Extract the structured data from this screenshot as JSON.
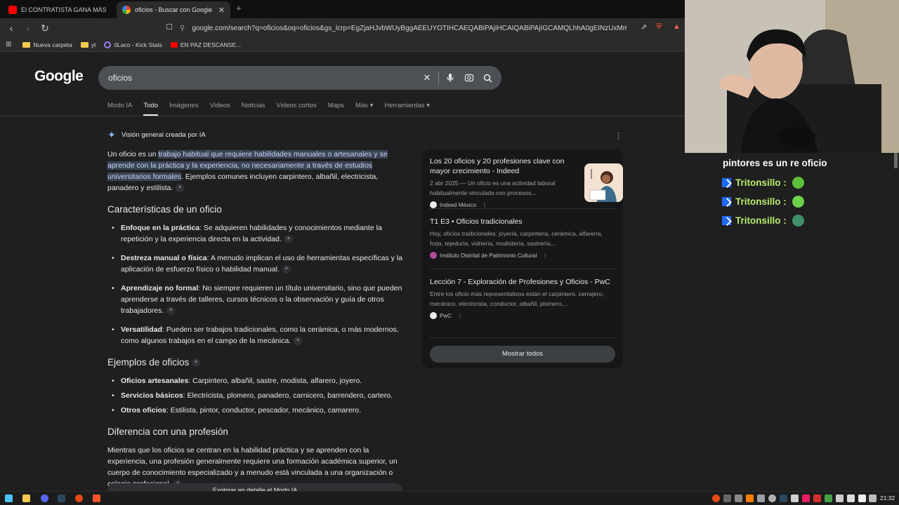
{
  "browser": {
    "tabs": [
      {
        "title": "El CONTRATISTA GANA MÁS #agente",
        "active": false
      },
      {
        "title": "oficios - Buscar con Google",
        "active": true
      }
    ],
    "new_tab": "+",
    "url": "google.com/search?q=oficios&oq=oficios&gs_lcrp=EgZjaHJvbWUyBggAEEUYOTIHCAEQABiPAjIHCAIQABiPAjIGCAMQLhhA0gEINzUxMmowajGoAgC...",
    "bookmarks": [
      {
        "label": "Nueva carpeta",
        "icon": "folder-icon"
      },
      {
        "label": "yt",
        "icon": "folder-icon"
      },
      {
        "label": "0Laco - Kick Stats",
        "icon": "kick-icon"
      },
      {
        "label": "EN PAZ DESCANSE...",
        "icon": "youtube-icon"
      }
    ]
  },
  "google": {
    "logo": "Google",
    "query": "oficios",
    "tabs": [
      "Modo IA",
      "Todo",
      "Imágenes",
      "Videos",
      "Noticias",
      "Videos cortos",
      "Maps",
      "Más",
      "Herramientas"
    ],
    "active_tab": "Todo"
  },
  "ai": {
    "header": "Visión general creada por IA",
    "intro_pre": "Un oficio es un ",
    "intro_hl": "trabajo habitual que requiere habilidades manuales o artesanales y se aprende con la práctica y la experiencia, no necesariamente a través de estudios universitarios formales",
    "intro_post": ". Ejemplos comunes incluyen carpintero, albañil, electricista, panadero y estilista.",
    "sec1_title": "Características de un oficio",
    "sec1_items": [
      {
        "bold": "Enfoque en la práctica",
        "text": ": Se adquieren habilidades y conocimientos mediante la repetición y la experiencia directa en la actividad."
      },
      {
        "bold": "Destreza manual o física",
        "text": ": A menudo implican el uso de herramientas específicas y la aplicación de esfuerzo físico o habilidad manual."
      },
      {
        "bold": "Aprendizaje no formal",
        "text": ": No siempre requieren un título universitario, sino que pueden aprenderse a través de talleres, cursos técnicos o la observación y guía de otros trabajadores."
      },
      {
        "bold": "Versatilidad",
        "text": ": Pueden ser trabajos tradicionales, como la cerámica, o más modernos, como algunos trabajos en el campo de la mecánica."
      }
    ],
    "sec2_title": "Ejemplos de oficios",
    "sec2_items": [
      {
        "bold": "Oficios artesanales",
        "text": ": Carpintero, albañil, sastre, modista, alfarero, joyero."
      },
      {
        "bold": "Servicios básicos",
        "text": ": Electricista, plomero, panadero, carnicero, barrendero, cartero."
      },
      {
        "bold": "Otros oficios",
        "text": ": Estilista, pintor, conductor, pescador, mecánico, camarero."
      }
    ],
    "sec3_title": "Diferencia con una profesión",
    "sec3_text": "Mientras que los oficios se centran en la habilidad práctica y se aprenden con la experiencia, una profesión generalmente requiere una formación académica superior, un cuerpo de conocimiento especializado y a menudo está vinculada a una organización o colegio profesional.",
    "explore_label": "Explorar en detalle el Modo IA"
  },
  "sources": [
    {
      "title": "Los 20 oficios y 20 profesiones clave con mayor crecimiento - Indeed",
      "desc": "2 abr 2025 — Un oficio es una actividad laboral habitualmente vinculada con procesos...",
      "site": "Indeed México",
      "color": "#e8eaed"
    },
    {
      "title": "T1 E3 • Oficios tradicionales",
      "desc": "Hoy, oficios tradicionales: joyería, carpintería, cerámica, alfarería, forja, tejeduría, vidriería, modistería, sastrería,...",
      "site": "Instituto Distrital de Patrimonio Cultural",
      "color": "#b04a9a"
    },
    {
      "title": "Lección 7 - Exploración de Profesiones y Oficios - PwC",
      "desc": "Entre los oficio más representativos están el carpintero, cerrajero, mecánico, electricista, conductor, albañil, plomero,...",
      "site": "PwC",
      "color": "#e8eaed"
    }
  ],
  "show_all": "Mostrar todos",
  "chat": {
    "first_line": "pintores es un re oficio",
    "messages": [
      {
        "user": "Tritonsillo :",
        "emote_color": "#5cbf3a"
      },
      {
        "user": "Tritonsillo :",
        "emote_color": "#6fd04b"
      },
      {
        "user": "Tritonsillo :",
        "emote_color": "#3f8f6a"
      }
    ]
  },
  "taskbar": {
    "clock": "21:32"
  }
}
